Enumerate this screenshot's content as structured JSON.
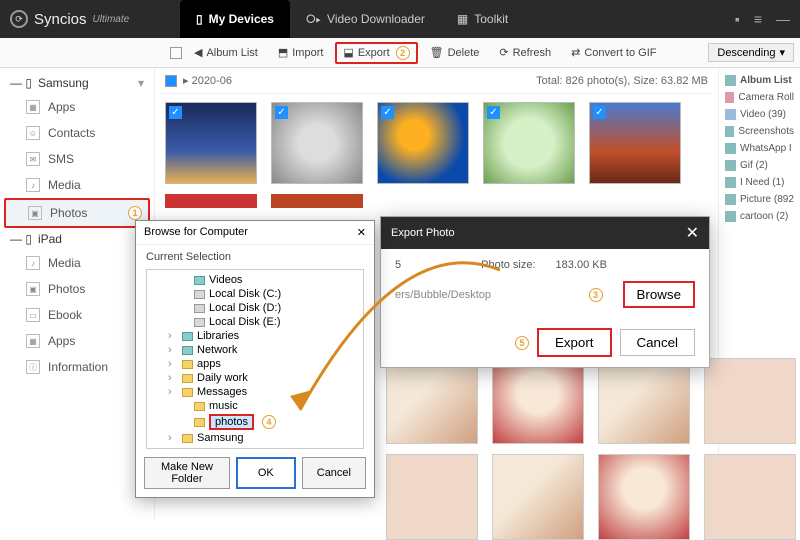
{
  "header": {
    "brand": "Syncios",
    "edition": "Ultimate",
    "tabs": [
      {
        "label": "My Devices",
        "active": true
      },
      {
        "label": "Video Downloader",
        "active": false
      },
      {
        "label": "Toolkit",
        "active": false
      }
    ]
  },
  "toolbar": {
    "album_list": "Album List",
    "import": "Import",
    "export": "Export",
    "delete": "Delete",
    "refresh": "Refresh",
    "convert": "Convert to GIF",
    "sort": "Descending"
  },
  "sidebar": {
    "devices": [
      {
        "name": "Samsung",
        "items": [
          "Apps",
          "Contacts",
          "SMS",
          "Media",
          "Photos"
        ],
        "selected": "Photos"
      },
      {
        "name": "iPad",
        "items": [
          "Media",
          "Photos",
          "Ebook",
          "Apps",
          "Information"
        ],
        "selected": ""
      }
    ]
  },
  "gallery": {
    "folder": "2020-06",
    "summary": "Total: 826 photo(s), Size: 63.82 MB",
    "selected_all": true
  },
  "right_panel": {
    "title": "Album List",
    "items": [
      "Camera Roll",
      "Video (39)",
      "Screenshots",
      "WhatsApp I",
      "Gif (2)",
      "I Need (1)",
      "Picture (892",
      "cartoon (2)"
    ]
  },
  "export_dialog": {
    "title": "Export Photo",
    "count_val": "5",
    "size_label": "Photo size:",
    "size_val": "183.00 KB",
    "path": "ers/Bubble/Desktop",
    "browse": "Browse",
    "export": "Export",
    "cancel": "Cancel"
  },
  "browse_dialog": {
    "title": "Browse for Computer",
    "subtitle": "Current Selection",
    "tree": [
      {
        "label": "Videos",
        "depth": 2,
        "type": "sys"
      },
      {
        "label": "Local Disk (C:)",
        "depth": 2,
        "type": "drive"
      },
      {
        "label": "Local Disk (D:)",
        "depth": 2,
        "type": "drive"
      },
      {
        "label": "Local Disk (E:)",
        "depth": 2,
        "type": "drive"
      },
      {
        "label": "Libraries",
        "depth": 1,
        "type": "sys"
      },
      {
        "label": "Network",
        "depth": 1,
        "type": "sys"
      },
      {
        "label": "apps",
        "depth": 1,
        "type": "folder"
      },
      {
        "label": "Daily work",
        "depth": 1,
        "type": "folder"
      },
      {
        "label": "Messages",
        "depth": 1,
        "type": "folder"
      },
      {
        "label": "music",
        "depth": 2,
        "type": "folder"
      },
      {
        "label": "photos",
        "depth": 2,
        "type": "folder",
        "selected": true
      },
      {
        "label": "Samsung",
        "depth": 1,
        "type": "folder"
      }
    ],
    "make_folder": "Make New Folder",
    "ok": "OK",
    "cancel": "Cancel"
  },
  "hints": {
    "h1": "1",
    "h2": "2",
    "h3": "3",
    "h4": "4",
    "h5": "5"
  }
}
